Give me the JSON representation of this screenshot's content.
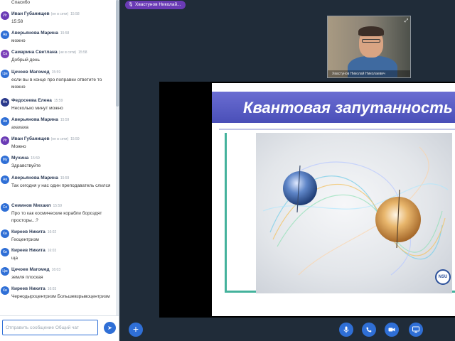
{
  "chat": {
    "previous_message": "Спасибо",
    "messages": [
      {
        "initials": "Иг",
        "name": "Иван Губанищев",
        "offline": "(не в сети)",
        "time": "15:58",
        "text": "15:58",
        "color": "#6a3bb5"
      },
      {
        "initials": "Ав",
        "name": "Аверьянова Марина",
        "offline": "",
        "time": "15:58",
        "text": "можно",
        "color": "#2f6fd6"
      },
      {
        "initials": "Са",
        "name": "Самарина Светлана",
        "offline": "(не в сети)",
        "time": "15:58",
        "text": "Добрый день",
        "color": "#7b3fb8"
      },
      {
        "initials": "Цм",
        "name": "Цечоев Магомед",
        "offline": "",
        "time": "15:59",
        "text": "если вы в конце про поправки ответите то можно",
        "color": "#2f6fd6"
      },
      {
        "initials": "Фе",
        "name": "Федосеева Елена",
        "offline": "",
        "time": "15:59",
        "text": "Несколько минут можно",
        "color": "#2b3a8c"
      },
      {
        "initials": "Ав",
        "name": "Аверьянова Марина",
        "offline": "",
        "time": "15:59",
        "text": "ахахаха",
        "color": "#2f6fd6"
      },
      {
        "initials": "Иг",
        "name": "Иван Губанищев",
        "offline": "(не в сети)",
        "time": "15:59",
        "text": "Можно",
        "color": "#6a3bb5"
      },
      {
        "initials": "Му",
        "name": "Мухина",
        "offline": "",
        "time": "15:59",
        "text": "Здравствуйте",
        "color": "#2f6fd6"
      },
      {
        "initials": "Ав",
        "name": "Аверьянова Марина",
        "offline": "",
        "time": "15:59",
        "text": "Так сегодня у нас один преподаватель слился",
        "color": "#2f6fd6"
      },
      {
        "initials": "Се",
        "name": "Семинов Михаил",
        "offline": "",
        "time": "15:59",
        "text": "Про то как космические корабли бороздят просторы...?",
        "color": "#2f6fd6"
      },
      {
        "initials": "Ки",
        "name": "Киреев Никита",
        "offline": "",
        "time": "16:02",
        "text": "Геоцентризм",
        "color": "#2f6fd6"
      },
      {
        "initials": "Ки",
        "name": "Киреев Никита",
        "offline": "",
        "time": "16:03",
        "text": "ща",
        "color": "#2f6fd6"
      },
      {
        "initials": "Цм",
        "name": "Цечоев Магомед",
        "offline": "",
        "time": "16:03",
        "text": "земля плоская",
        "color": "#2f6fd6"
      },
      {
        "initials": "Ки",
        "name": "Киреев Никита",
        "offline": "",
        "time": "16:03",
        "text": "Чернодыроцентризм Большевзрывоцентризм",
        "color": "#2f6fd6"
      }
    ],
    "input_placeholder": "Отправить сообщение Общий чат",
    "send_icon": "send-arrow"
  },
  "presenter": {
    "name": "Хвастунов Николай...",
    "webcam_caption": "Хвастунов Николай Николаевич"
  },
  "slide": {
    "title": "Квантовая запутанность",
    "logo_text": "NSU"
  },
  "toolbar": {
    "add_symbol": "+",
    "icons": [
      "plus-icon",
      "microphone-icon",
      "phone-icon",
      "camera-icon",
      "screen-share-icon"
    ],
    "accent_color": "#2f6fd6"
  }
}
